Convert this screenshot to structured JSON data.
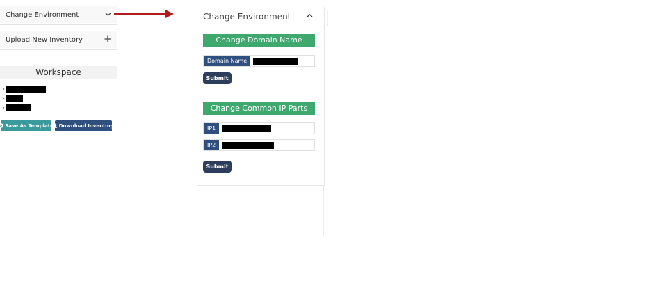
{
  "sidebar": {
    "change_environment": {
      "label": "Change Environment",
      "icon": "chevron-down-icon"
    },
    "upload_inventory": {
      "label": "Upload New Inventory",
      "icon": "plus-icon"
    },
    "workspace": {
      "title": "Workspace",
      "items": [
        {
          "label": ""
        },
        {
          "label": ""
        },
        {
          "label": ""
        }
      ]
    },
    "buttons": {
      "save_template": "Save As Template",
      "download_inventory": "Download Inventory"
    }
  },
  "panel": {
    "title": "Change Environment",
    "domain_section": {
      "heading": "Change Domain Name",
      "field_label": "Domain Name",
      "field_value": "",
      "submit": "Submit"
    },
    "ip_section": {
      "heading": "Change Common IP Parts",
      "fields": [
        {
          "label": "IP1",
          "value": ""
        },
        {
          "label": "IP2",
          "value": ""
        }
      ],
      "submit": "Submit"
    }
  },
  "colors": {
    "green": "#3fa86f",
    "navy": "#2f4f7f",
    "teal": "#3b9a9c",
    "arrow": "#b01c1c"
  }
}
